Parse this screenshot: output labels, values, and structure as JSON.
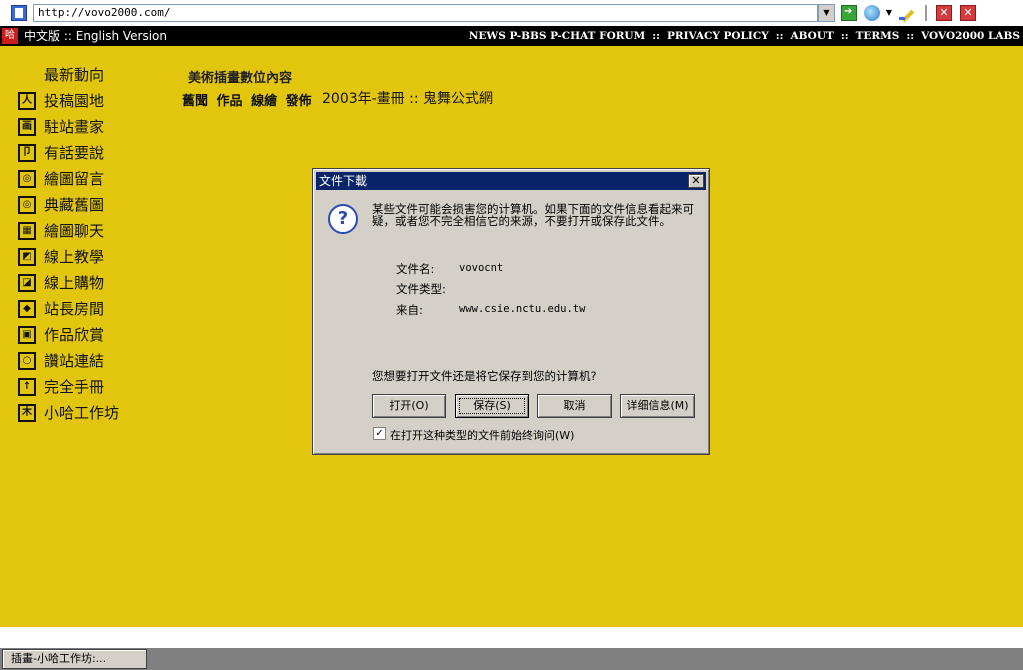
{
  "browser": {
    "url": "http://vovo2000.com/"
  },
  "site": {
    "logo_text": "哈",
    "lang": {
      "chinese": "中文版",
      "separator": " :: ",
      "english": "English Version"
    },
    "topnav": [
      "NEWS P-BBS P-CHAT FORUM",
      "PRIVACY POLICY",
      "ABOUT",
      "TERMS",
      "VOVO2000 LABS"
    ],
    "topnav_separator": "::",
    "sidebar": [
      {
        "label": "最新動向",
        "icon": ""
      },
      {
        "label": "投稿園地",
        "icon": "人"
      },
      {
        "label": "駐站畫家",
        "icon": "画"
      },
      {
        "label": "有話要說",
        "icon": "卩"
      },
      {
        "label": "繪圖留言",
        "icon": "◎"
      },
      {
        "label": "典藏舊圖",
        "icon": "◎"
      },
      {
        "label": "繪圖聊天",
        "icon": "▦"
      },
      {
        "label": "線上教學",
        "icon": "◩"
      },
      {
        "label": "線上購物",
        "icon": "◪"
      },
      {
        "label": "站長房間",
        "icon": "◆"
      },
      {
        "label": "作品欣賞",
        "icon": "▣"
      },
      {
        "label": "讚站連結",
        "icon": "○"
      },
      {
        "label": "完全手冊",
        "icon": "↑"
      },
      {
        "label": "小哈工作坊",
        "icon": "木"
      }
    ],
    "content": {
      "heading": "美術插畫數位內容",
      "tabs": [
        "舊聞",
        "作品",
        "線繪",
        "發佈"
      ],
      "title": "2003年-畫冊 :: 鬼舞公式網"
    }
  },
  "dialog": {
    "title": "文件下載",
    "close_glyph": "✕",
    "icon_glyph": "?",
    "warning": "某些文件可能会损害您的计算机。如果下面的文件信息看起来可疑，或者您不完全相信它的来源，不要打开或保存此文件。",
    "fields": [
      {
        "label": "文件名:",
        "value": "vovocnt"
      },
      {
        "label": "文件类型:",
        "value": ""
      },
      {
        "label": "来自:",
        "value": "www.csie.nctu.edu.tw"
      }
    ],
    "question": "您想要打开文件还是将它保存到您的计算机?",
    "buttons": {
      "open": "打开(O)",
      "save": "保存(S)",
      "cancel": "取消",
      "details": "详细信息(M)"
    },
    "checkbox": {
      "checked": true,
      "mark": "✓",
      "label": "在打开这种类型的文件前始终询问(W)"
    }
  },
  "taskbar": {
    "task_label": "插畫-小哈工作坊:..."
  },
  "colors": {
    "page_background": "#e2c60e",
    "topbar": "#000000",
    "dialog_titlebar": "#0a246a"
  }
}
